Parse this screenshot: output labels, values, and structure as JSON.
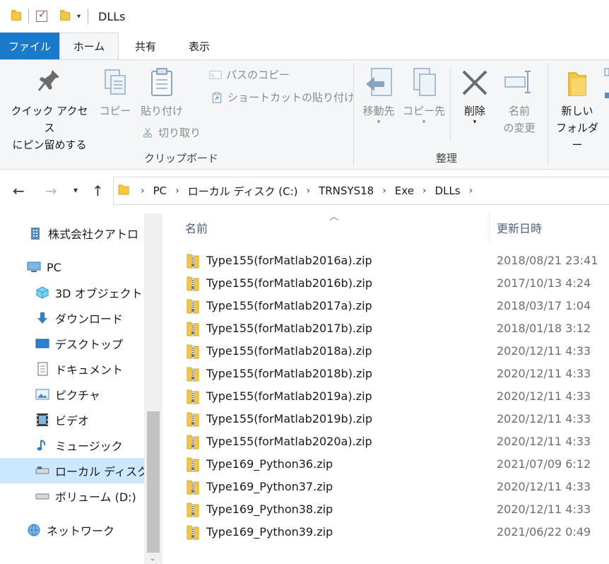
{
  "window": {
    "title": "DLLs"
  },
  "tabs": {
    "file": "ファイル",
    "home": "ホーム",
    "share": "共有",
    "view": "表示"
  },
  "ribbon": {
    "pin_quick_access_line1": "クイック アクセス",
    "pin_quick_access_line2": "にピン留めする",
    "copy": "コピー",
    "paste": "貼り付け",
    "copy_path": "パスのコピー",
    "paste_shortcut": "ショートカットの貼り付け",
    "cut": "切り取り",
    "clipboard_group": "クリップボード",
    "move_to": "移動先",
    "copy_to": "コピー先",
    "delete": "削除",
    "rename_line1": "名前",
    "rename_line2": "の変更",
    "new_folder_line1": "新しい",
    "new_folder_line2": "フォルダー",
    "organize_group": "整理"
  },
  "address": {
    "crumbs": [
      "PC",
      "ローカル ディスク (C:)",
      "TRNSYS18",
      "Exe",
      "DLLs"
    ]
  },
  "sidebar": {
    "items": [
      {
        "label": "株式会社クアトロ"
      },
      {
        "label": "PC"
      },
      {
        "label": "3D オブジェクト"
      },
      {
        "label": "ダウンロード"
      },
      {
        "label": "デスクトップ"
      },
      {
        "label": "ドキュメント"
      },
      {
        "label": "ピクチャ"
      },
      {
        "label": "ビデオ"
      },
      {
        "label": "ミュージック"
      },
      {
        "label": "ローカル ディスク (C"
      },
      {
        "label": "ボリューム (D:)"
      },
      {
        "label": "ネットワーク"
      }
    ]
  },
  "filelist": {
    "col_name": "名前",
    "col_modified": "更新日時",
    "files": [
      {
        "name": "Type155(forMatlab2016a).zip",
        "modified": "2018/08/21 23:41"
      },
      {
        "name": "Type155(forMatlab2016b).zip",
        "modified": "2017/10/13 4:24"
      },
      {
        "name": "Type155(forMatlab2017a).zip",
        "modified": "2018/03/17 1:04"
      },
      {
        "name": "Type155(forMatlab2017b).zip",
        "modified": "2018/01/18 3:12"
      },
      {
        "name": "Type155(forMatlab2018a).zip",
        "modified": "2020/12/11 4:33"
      },
      {
        "name": "Type155(forMatlab2018b).zip",
        "modified": "2020/12/11 4:33"
      },
      {
        "name": "Type155(forMatlab2019a).zip",
        "modified": "2020/12/11 4:33"
      },
      {
        "name": "Type155(forMatlab2019b).zip",
        "modified": "2020/12/11 4:33"
      },
      {
        "name": "Type155(forMatlab2020a).zip",
        "modified": "2020/12/11 4:33"
      },
      {
        "name": "Type169_Python36.zip",
        "modified": "2021/07/09 6:12"
      },
      {
        "name": "Type169_Python37.zip",
        "modified": "2020/12/11 4:33"
      },
      {
        "name": "Type169_Python38.zip",
        "modified": "2020/12/11 4:33"
      },
      {
        "name": "Type169_Python39.zip",
        "modified": "2021/06/22 0:49"
      }
    ]
  },
  "colors": {
    "file_tab": "#1979ca",
    "selected": "#cce8ff",
    "folder": "#f5c842"
  }
}
